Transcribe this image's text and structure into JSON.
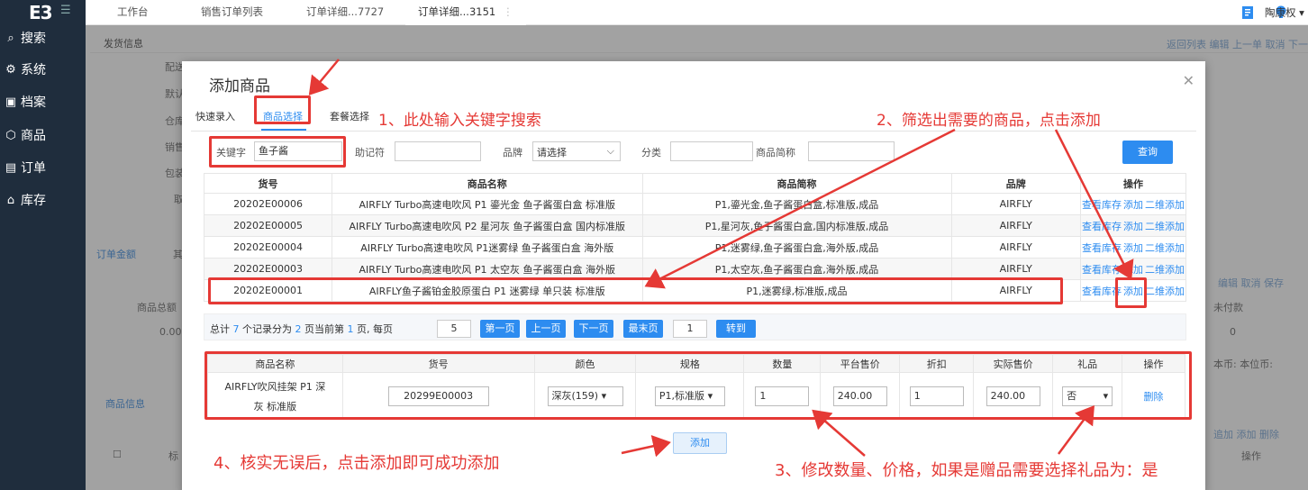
{
  "app": {
    "logo": "E3",
    "user_name": "陶康权"
  },
  "sidebar": {
    "items": [
      {
        "label": "搜索",
        "icon": "search-icon"
      },
      {
        "label": "系统",
        "icon": "gear-icon"
      },
      {
        "label": "档案",
        "icon": "archive-icon"
      },
      {
        "label": "商品",
        "icon": "box-icon"
      },
      {
        "label": "订单",
        "icon": "order-icon"
      },
      {
        "label": "库存",
        "icon": "home-icon"
      }
    ]
  },
  "tabs": [
    {
      "label": "工作台"
    },
    {
      "label": "销售订单列表"
    },
    {
      "label": "订单详细...7727"
    },
    {
      "label": "订单详细...3151"
    }
  ],
  "background": {
    "section_shipping": "发货信息",
    "labels": [
      "配送",
      "默认",
      "仓库",
      "销售",
      "包装",
      "取"
    ],
    "actions_top": "返回列表  编辑  上一单  取消  下一单  保存",
    "order_amount_tab": "订单金额",
    "other_tab": "其",
    "product_total": "商品总额",
    "product_total_value": "0.00",
    "actions_mid": "编辑  取消  保存",
    "unpaid": "未付款",
    "unpaid_value": "0",
    "currency": "本币:   本位币:",
    "product_info_tab": "商品信息",
    "actions_list": "追加  添加  删除",
    "col_label": "标",
    "col_op": "操作"
  },
  "modal": {
    "title": "添加商品",
    "tabs": [
      "快速录入",
      "商品选择",
      "套餐选择"
    ],
    "filters": {
      "keyword_label": "关键字",
      "keyword_value": "鱼子酱",
      "mnemonic_label": "助记符",
      "brand_label": "品牌",
      "brand_value": "请选择",
      "category_label": "分类",
      "short_name_label": "商品简称",
      "query_button": "查询"
    },
    "results": {
      "headers": [
        "货号",
        "商品名称",
        "商品简称",
        "品牌",
        "操作"
      ],
      "actions": [
        "查看库存",
        "添加",
        "二维添加"
      ],
      "rows": [
        {
          "sku": "20202E00006",
          "name": "AIRFLY Turbo高速电吹风 P1 鎏光金 鱼子酱蛋白盒 标准版",
          "short": "P1,鎏光金,鱼子酱蛋白盒,标准版,成品",
          "brand": "AIRFLY"
        },
        {
          "sku": "20202E00005",
          "name": "AIRFLY Turbo高速电吹风 P2 星河灰 鱼子酱蛋白盒 国内标准版",
          "short": "P1,星河灰,鱼子酱蛋白盒,国内标准版,成品",
          "brand": "AIRFLY"
        },
        {
          "sku": "20202E00004",
          "name": "AIRFLY Turbo高速电吹风 P1迷雾绿 鱼子酱蛋白盒 海外版",
          "short": "P1,迷雾绿,鱼子酱蛋白盒,海外版,成品",
          "brand": "AIRFLY"
        },
        {
          "sku": "20202E00003",
          "name": "AIRFLY Turbo高速电吹风 P1 太空灰 鱼子酱蛋白盒 海外版",
          "short": "P1,太空灰,鱼子酱蛋白盒,海外版,成品",
          "brand": "AIRFLY"
        },
        {
          "sku": "20202E00001",
          "name": "AIRFLY鱼子酱铂金胶原蛋白 P1 迷雾绿 单只装 标准版",
          "short": "P1,迷雾绿,标准版,成品",
          "brand": "AIRFLY"
        }
      ]
    },
    "pager": {
      "total_prefix": "总计",
      "total": "7",
      "records_text": "个记录分为",
      "pages": "2",
      "current_text": "页当前第",
      "current": "1",
      "per_page_text": "页, 每页",
      "per_page": "5",
      "first": "第一页",
      "prev": "上一页",
      "next": "下一页",
      "last": "最末页",
      "goto_value": "1",
      "goto": "转到"
    },
    "selected": {
      "headers": [
        "商品名称",
        "货号",
        "颜色",
        "规格",
        "数量",
        "平台售价",
        "折扣",
        "实际售价",
        "礼品",
        "操作"
      ],
      "row": {
        "name_line1": "AIRFLY吹风挂架 P1 深",
        "name_line2": "灰 标准版",
        "sku": "20299E00003",
        "color": "深灰(159)",
        "spec": "P1,标准版",
        "qty": "1",
        "platform_price": "240.00",
        "discount": "1",
        "actual_price": "240.00",
        "gift": "否",
        "delete": "删除"
      }
    },
    "add_button": "添加"
  },
  "annotations": {
    "step1": "1、此处输入关键字搜索",
    "step2": "2、筛选出需要的商品，点击添加",
    "step3": "3、修改数量、价格，如果是赠品需要选择礼品为：是",
    "step4": "4、核实无误后，点击添加即可成功添加"
  },
  "colors": {
    "sidebar": "#1f2d3d",
    "accent": "#2d8cf0",
    "annotation": "#e53935"
  }
}
